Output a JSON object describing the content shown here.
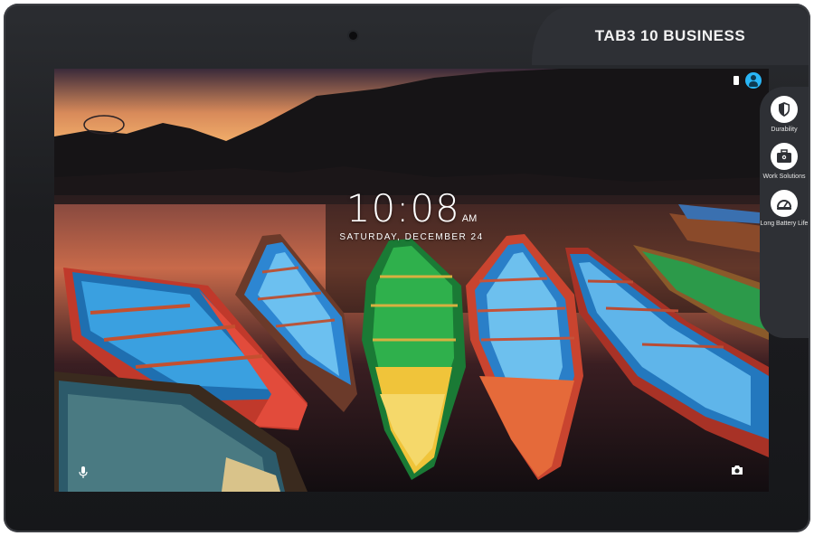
{
  "device": {
    "brand_label": "TAB3 10 BUSINESS"
  },
  "lockscreen": {
    "time": "10:08",
    "ampm": "AM",
    "date": "SATURDAY, DECEMBER 24"
  },
  "features": [
    {
      "label": "Durability",
      "icon": "shield-icon"
    },
    {
      "label": "Work Solutions",
      "icon": "briefcase-icon"
    },
    {
      "label": "Long Battery Life",
      "icon": "battery-gauge-icon"
    }
  ],
  "colors": {
    "bezel": "#1c1d20",
    "tab_panel": "#2e3035",
    "accent_user": "#29b6f6"
  }
}
